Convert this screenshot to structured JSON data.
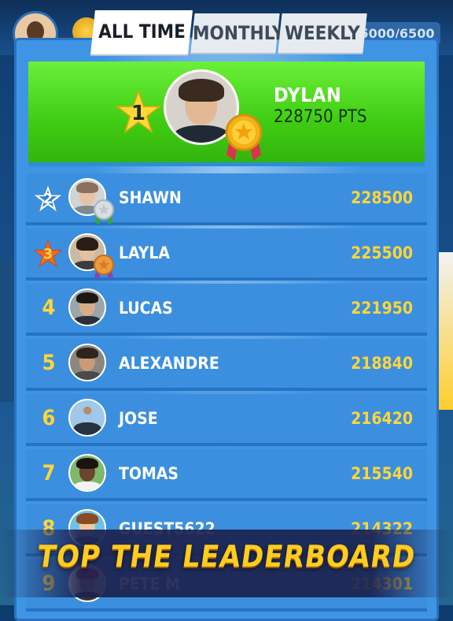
{
  "background": {
    "counter_text": "5000/6500"
  },
  "tabs": [
    {
      "label": "ALL TIME",
      "active": true
    },
    {
      "label": "MONTHLY",
      "active": false
    },
    {
      "label": "WEEKLY",
      "active": false
    }
  ],
  "leader": {
    "rank": "1",
    "name": "DYLAN",
    "points": "228750 PTS",
    "medal": "gold"
  },
  "entries": [
    {
      "rank": "2",
      "name": "SHAWN",
      "score": "228500",
      "badge": "star-silver",
      "medal": "silver"
    },
    {
      "rank": "3",
      "name": "LAYLA",
      "score": "225500",
      "badge": "star-bronze",
      "medal": "bronze"
    },
    {
      "rank": "4",
      "name": "LUCAS",
      "score": "221950"
    },
    {
      "rank": "5",
      "name": "ALEXANDRE",
      "score": "218840"
    },
    {
      "rank": "6",
      "name": "JOSE",
      "score": "216420"
    },
    {
      "rank": "7",
      "name": "TOMAS",
      "score": "215540"
    },
    {
      "rank": "8",
      "name": "GUEST5622",
      "score": "214322"
    },
    {
      "rank": "9",
      "name": "PETE M",
      "score": "214301"
    }
  ],
  "banner": {
    "text": "TOP THE LEADERBOARD"
  },
  "colors": {
    "panel": "#3f95e4",
    "leader_green": "#3fcc12",
    "score_yellow": "#ffd53a",
    "banner_gold": "#ffcc1f"
  }
}
